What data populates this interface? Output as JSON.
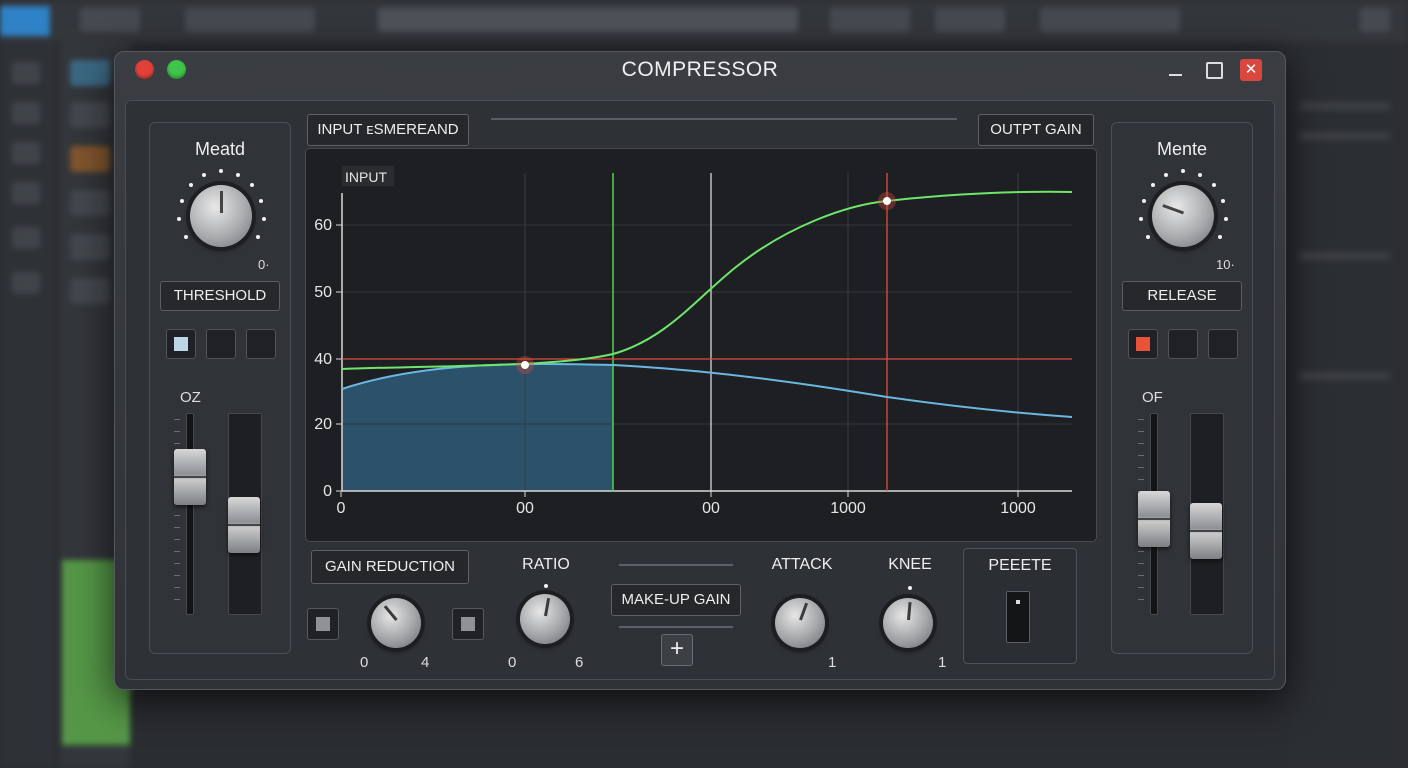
{
  "window": {
    "title": "COMPRESSOR",
    "close_glyph": "✕"
  },
  "left_panel": {
    "title": "Meatd",
    "knob_value": "0·",
    "button_label": "THRESHOLD",
    "fader_label": "OZ"
  },
  "right_panel": {
    "title": "Mente",
    "knob_value": "10·",
    "button_label": "RELEASE",
    "fader_label": "OF"
  },
  "graph": {
    "tab_left": "INPUT ᴇSMEREAND",
    "tab_right": "OUTPT GAIN",
    "inner_label": "INPUT"
  },
  "chart_data": {
    "type": "line",
    "y_ticks": [
      "60",
      "50",
      "40",
      "20",
      "0"
    ],
    "x_ticks": [
      "0",
      "00",
      "00",
      "1000",
      "1000"
    ],
    "series": [
      {
        "color": "#6ee66a"
      },
      {
        "color": "#6ab8e0"
      }
    ],
    "lines": [
      {
        "color": "#e34b3f"
      }
    ],
    "accent_green": "#4fd34f",
    "accent_red": "#e34b3f",
    "fill": "#2e5a78"
  },
  "controls": {
    "gain_reduction": {
      "label": "GAIN REDUCTION",
      "min": "0",
      "max": "4"
    },
    "ratio": {
      "label": "RATIO",
      "min": "0",
      "max": "6"
    },
    "makeup_gain": {
      "label": "MAKE-UP GAIN",
      "plus": "+"
    },
    "attack": {
      "label": "ATTACK",
      "max": "1"
    },
    "knee": {
      "label": "KNEE",
      "max": "1"
    },
    "preset": {
      "label": "PEEETE"
    }
  },
  "icons": {
    "close": "close-icon",
    "minimize": "minimize-icon",
    "maximize": "maximize-icon"
  }
}
